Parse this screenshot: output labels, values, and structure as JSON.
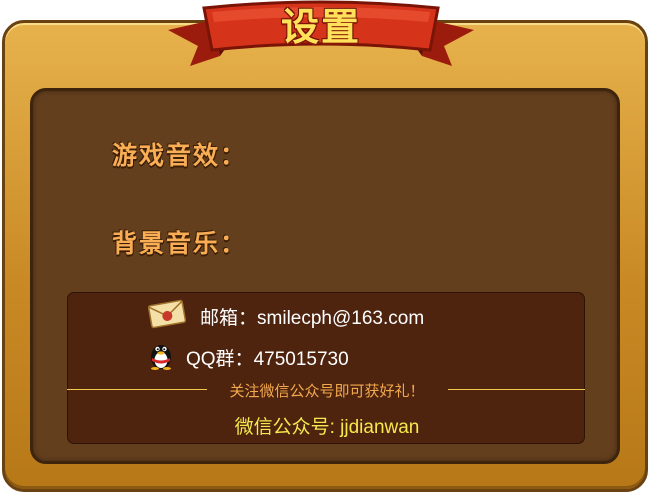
{
  "dialog": {
    "title": "设置"
  },
  "settings": {
    "sound_effects_label": "游戏音效：",
    "music_label": "背景音乐："
  },
  "contact": {
    "email_label": "邮箱：",
    "email_value": "smilecph@163.com",
    "qq_group_label": "QQ群：",
    "qq_group_value": "475015730",
    "notice": "关注微信公众号即可获好礼！",
    "wechat_label": "微信公众号:",
    "wechat_value": "jjdianwan"
  },
  "icons": {
    "email": "envelope-icon",
    "qq": "qq-penguin-icon"
  },
  "colors": {
    "frame": "#d49a33",
    "panel": "#643f1e",
    "info_box": "#4e240f",
    "ribbon": "#d6331b",
    "title_text": "#ffe25a",
    "label_text": "#f9ad54",
    "notice_text": "#f3a94d",
    "wechat_text": "#f6e94e"
  }
}
